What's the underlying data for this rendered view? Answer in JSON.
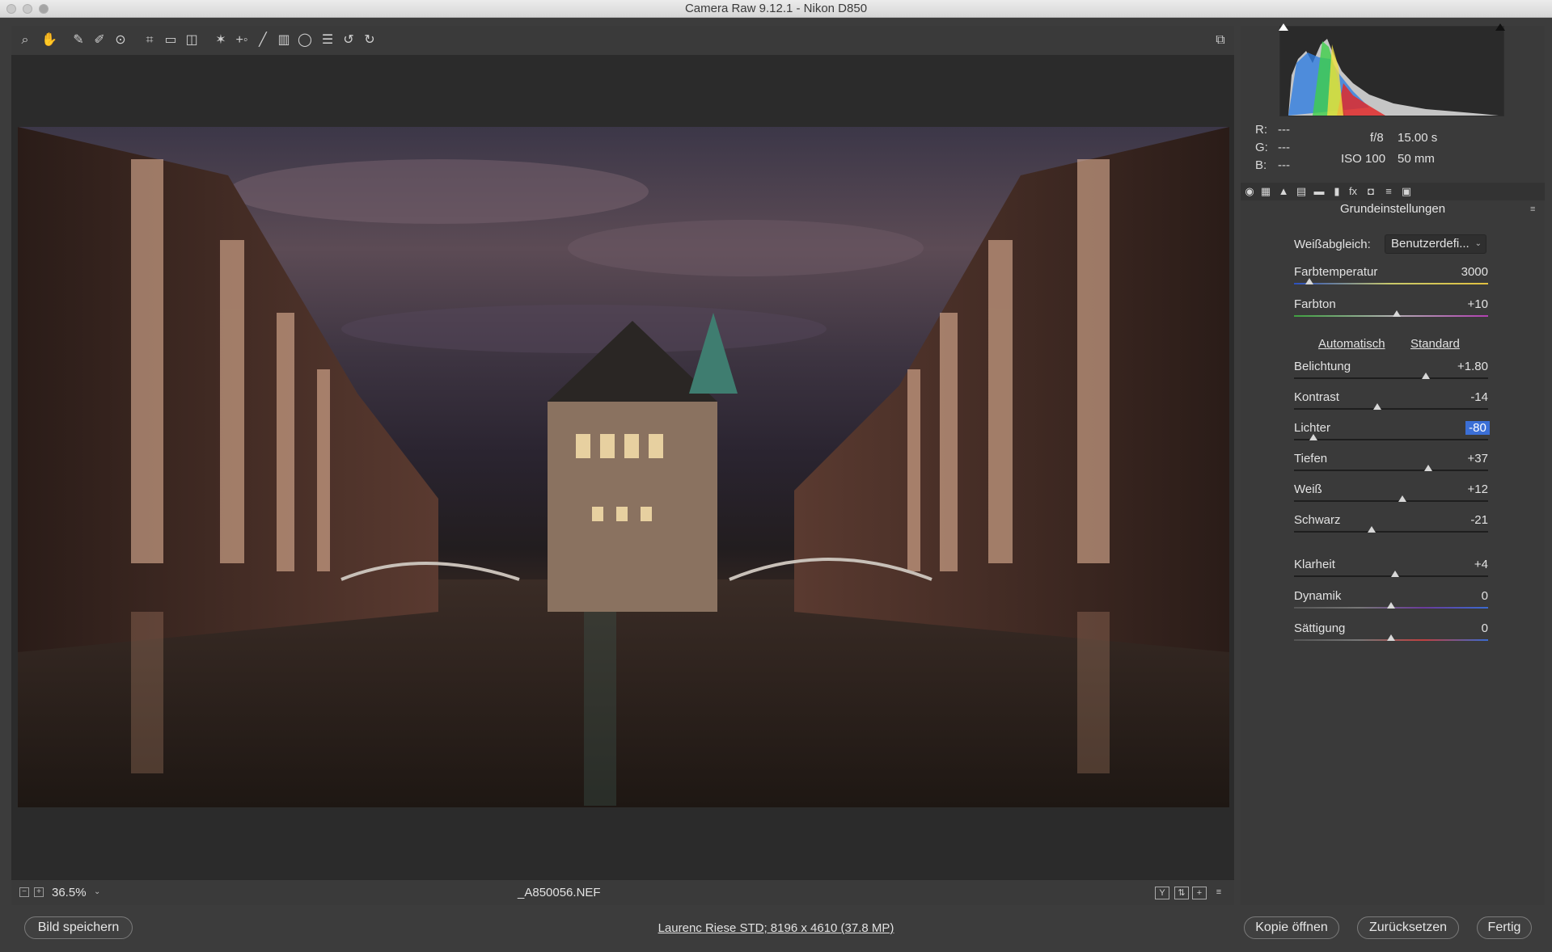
{
  "window": {
    "title": "Camera Raw 9.12.1 - Nikon D850"
  },
  "toolbar": {
    "tools": [
      "zoom-icon",
      "hand-icon",
      "eyedropper-icon",
      "color-sampler-icon",
      "target-adjust-icon",
      "crop-icon",
      "straighten-icon",
      "transform-icon",
      "spot-removal-icon",
      "red-eye-icon",
      "adjustment-brush-icon",
      "graduated-filter-icon",
      "radial-filter-icon",
      "preferences-icon",
      "rotate-left-icon",
      "rotate-right-icon"
    ],
    "fullscreen_icon": "fullscreen-icon"
  },
  "histogram": {
    "shadow_clip": "shadow-clipping-icon",
    "highlight_clip": "highlight-clipping-icon"
  },
  "readout": {
    "r_label": "R:",
    "r_value": "---",
    "g_label": "G:",
    "g_value": "---",
    "b_label": "B:",
    "b_value": "---"
  },
  "exif": {
    "aperture": "f/8",
    "shutter": "15.00 s",
    "iso": "ISO 100",
    "focal": "50 mm"
  },
  "panel": {
    "title": "Grundeinstellungen",
    "white_balance_label": "Weißabgleich:",
    "white_balance_value": "Benutzerdefi...",
    "auto_link": "Automatisch",
    "default_link": "Standard",
    "sliders": [
      {
        "label": "Farbtemperatur",
        "value": "3000",
        "position": 0.08
      },
      {
        "label": "Farbton",
        "value": "+10",
        "position": 0.53
      },
      {
        "label": "Belichtung",
        "value": "+1.80",
        "position": 0.68
      },
      {
        "label": "Kontrast",
        "value": "-14",
        "position": 0.43
      },
      {
        "label": "Lichter",
        "value": "-80",
        "position": 0.1
      },
      {
        "label": "Tiefen",
        "value": "+37",
        "position": 0.69
      },
      {
        "label": "Weiß",
        "value": "+12",
        "position": 0.56
      },
      {
        "label": "Schwarz",
        "value": "-21",
        "position": 0.4
      },
      {
        "label": "Klarheit",
        "value": "+4",
        "position": 0.52
      },
      {
        "label": "Dynamik",
        "value": "0",
        "position": 0.5
      },
      {
        "label": "Sättigung",
        "value": "0",
        "position": 0.5
      }
    ]
  },
  "statusbar": {
    "zoom": "36.5%",
    "filename": "_A850056.NEF"
  },
  "bottombar": {
    "save_button": "Bild speichern",
    "image_info": "Laurenc Riese STD; 8196 x 4610 (37.8 MP)",
    "open_copy_button": "Kopie öffnen",
    "reset_button": "Zurücksetzen",
    "done_button": "Fertig"
  },
  "colors": {
    "panel_bg": "#3a3a3a",
    "canvas_bg": "#2b2b2b",
    "selection": "#3b6fd6"
  }
}
